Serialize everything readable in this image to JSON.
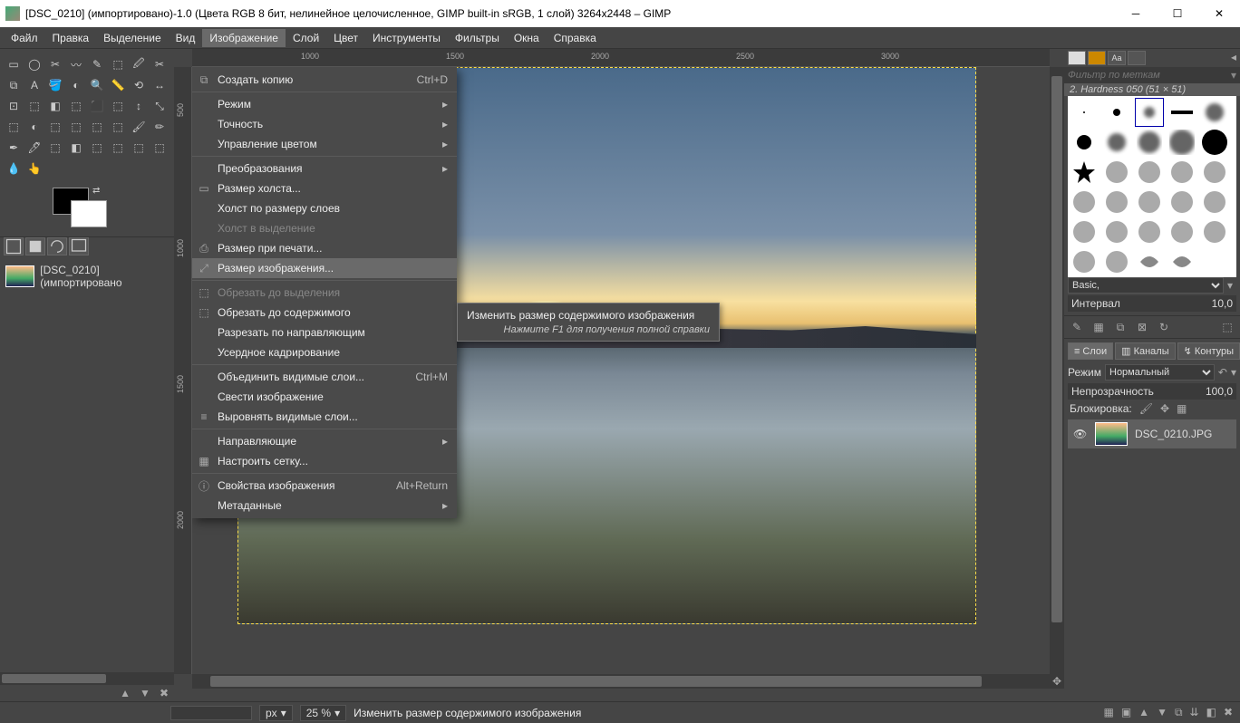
{
  "titlebar": {
    "text": "[DSC_0210] (импортировано)-1.0 (Цвета RGB 8 бит, нелинейное целочисленное, GIMP built-in sRGB, 1 слой) 3264x2448 – GIMP"
  },
  "menubar": {
    "items": [
      "Файл",
      "Правка",
      "Выделение",
      "Вид",
      "Изображение",
      "Слой",
      "Цвет",
      "Инструменты",
      "Фильтры",
      "Окна",
      "Справка"
    ],
    "active_index": 4
  },
  "dropdown": {
    "items": [
      {
        "type": "item",
        "icon": "duplicate",
        "label": "Создать копию",
        "shortcut": "Ctrl+D"
      },
      {
        "type": "sep"
      },
      {
        "type": "sub",
        "label": "Режим"
      },
      {
        "type": "sub",
        "label": "Точность"
      },
      {
        "type": "sub",
        "label": "Управление цветом"
      },
      {
        "type": "sep"
      },
      {
        "type": "sub",
        "label": "Преобразования"
      },
      {
        "type": "item",
        "icon": "canvas",
        "label": "Размер холста..."
      },
      {
        "type": "item",
        "label": "Холст по размеру слоев"
      },
      {
        "type": "item",
        "label": "Холст в выделение",
        "disabled": true
      },
      {
        "type": "item",
        "icon": "print",
        "label": "Размер при печати..."
      },
      {
        "type": "item",
        "icon": "scale",
        "label": "Размер изображения...",
        "hover": true
      },
      {
        "type": "sep"
      },
      {
        "type": "item",
        "icon": "crop",
        "label": "Обрезать до выделения",
        "disabled": true
      },
      {
        "type": "item",
        "icon": "crop",
        "label": "Обрезать до содержимого"
      },
      {
        "type": "item",
        "label": "Разрезать по направляющим"
      },
      {
        "type": "item",
        "label": "Усердное кадрирование"
      },
      {
        "type": "sep"
      },
      {
        "type": "item",
        "label": "Объединить видимые слои...",
        "shortcut": "Ctrl+M"
      },
      {
        "type": "item",
        "label": "Свести изображение"
      },
      {
        "type": "item",
        "icon": "align",
        "label": "Выровнять видимые слои..."
      },
      {
        "type": "sep"
      },
      {
        "type": "sub",
        "label": "Направляющие"
      },
      {
        "type": "item",
        "icon": "grid",
        "label": "Настроить сетку..."
      },
      {
        "type": "sep"
      },
      {
        "type": "item",
        "icon": "info",
        "label": "Свойства изображения",
        "shortcut": "Alt+Return"
      },
      {
        "type": "sub",
        "label": "Метаданные"
      }
    ]
  },
  "tooltip": {
    "line1": "Изменить размер содержимого изображения",
    "line2": "Нажмите F1 для получения полной справки"
  },
  "left_panel": {
    "layer_name": "[DSC_0210] (импортировано"
  },
  "ruler_h": [
    "1000",
    "1500",
    "2000",
    "2500",
    "3000"
  ],
  "ruler_v": [
    "500",
    "1000",
    "1500",
    "2000"
  ],
  "statusbar": {
    "unit": "px",
    "zoom": "25 %",
    "message": "Изменить размер содержимого изображения"
  },
  "right_panel": {
    "filter_placeholder": "Фильтр по меткам",
    "brush_label": "2. Hardness 050 (51 × 51)",
    "preset": "Basic,",
    "interval_label": "Интервал",
    "interval_value": "10,0",
    "tabs": {
      "layers": "Слои",
      "channels": "Каналы",
      "paths": "Контуры"
    },
    "mode_label": "Режим",
    "mode_value": "Нормальный",
    "opacity_label": "Непрозрачность",
    "opacity_value": "100,0",
    "lock_label": "Блокировка:",
    "layer_name": "DSC_0210.JPG"
  }
}
